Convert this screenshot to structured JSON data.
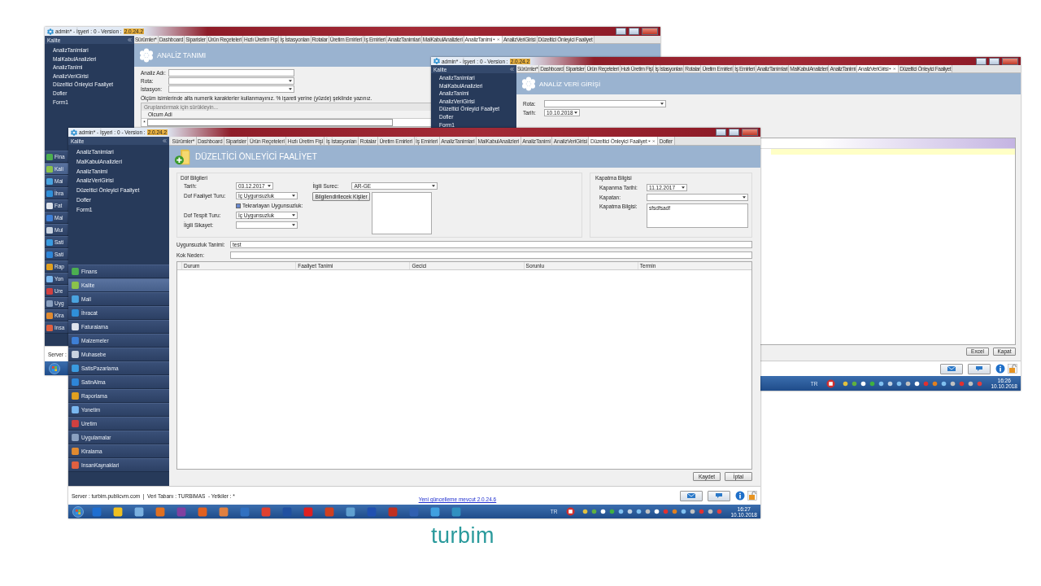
{
  "back_window": {
    "title": "admin* - İşyeri : 0 - Version :",
    "version": "2.0.24.2",
    "sidebar": {
      "header": "Kalite",
      "items": [
        "AnalizTanimlari",
        "MalKabulAnalizleri",
        "AnalizTanimi",
        "AnalizVeriGirisi",
        "Düzeltici Önleyici Faaliyet",
        "Dofler",
        "Form1"
      ]
    },
    "modules": [
      {
        "label": "Fina",
        "selected": false
      },
      {
        "label": "Kali",
        "selected": true
      },
      {
        "label": "Mai",
        "selected": false
      },
      {
        "label": "İhra",
        "selected": false
      },
      {
        "label": "Fat",
        "selected": false
      },
      {
        "label": "Mal",
        "selected": false
      },
      {
        "label": "Mul",
        "selected": false
      },
      {
        "label": "Sati",
        "selected": false
      },
      {
        "label": "Sati",
        "selected": false
      },
      {
        "label": "Rap",
        "selected": false
      },
      {
        "label": "Yon",
        "selected": false
      },
      {
        "label": "Ure",
        "selected": false
      },
      {
        "label": "Uyg",
        "selected": false
      },
      {
        "label": "Kira",
        "selected": false
      },
      {
        "label": "Insa",
        "selected": false
      }
    ],
    "tabs": [
      {
        "label": "Sürümler*",
        "selected": false
      },
      {
        "label": "Dashboard",
        "selected": false
      },
      {
        "label": "Siparisler",
        "selected": false
      },
      {
        "label": "Ürün Reçeteleri",
        "selected": false
      },
      {
        "label": "Hızlı Üretim Fişi",
        "selected": false
      },
      {
        "label": "İş İstasyonları",
        "selected": false
      },
      {
        "label": "Rotalar",
        "selected": false
      },
      {
        "label": "Üretim Emirleri",
        "selected": false
      },
      {
        "label": "İş Emirleri",
        "selected": false
      },
      {
        "label": "AnalizTanimlari",
        "selected": false
      },
      {
        "label": "MalKabulAnalizleri",
        "selected": false
      },
      {
        "label": "AnalizTanimi",
        "selected": true
      },
      {
        "label": "AnalizVeriGirisi",
        "selected": false
      },
      {
        "label": "Düzeltici Önleyici Faaliyet",
        "selected": false
      }
    ],
    "page_title": "ANALİZ TANIMI",
    "fields": [
      {
        "label": "Analiz Adı:",
        "kind": "text"
      },
      {
        "label": "Rota:",
        "kind": "dropdown"
      },
      {
        "label": "İstasyon:",
        "kind": "dropdown"
      }
    ],
    "note": "Ölçüm isimlerinde alfa numerik karakterler kullanmayınız. % işareti yerine (yüzde) şeklinde yazınız.",
    "grid": {
      "group_hint": "Gruplandırmak için sürükleyin...",
      "columns": [
        "Olcum Adi"
      ],
      "new_row_marker": "*"
    },
    "status": "Server :"
  },
  "middle_window": {
    "title": "admin* - İşyeri : 0 - Version :",
    "version": "2.0.24.2",
    "sidebar": {
      "header": "Kalite",
      "items": [
        "AnalizTanimlari",
        "MalKabulAnalizleri",
        "AnalizTanimi",
        "AnalizVeriGirisi",
        "Düzeltici Önleyici Faaliyet",
        "Dofler",
        "Form1"
      ]
    },
    "tabs": [
      {
        "label": "Sürümler*",
        "selected": false
      },
      {
        "label": "Dashboard",
        "selected": false
      },
      {
        "label": "Siparisler",
        "selected": false
      },
      {
        "label": "Ürün Reçeteleri",
        "selected": false
      },
      {
        "label": "Hızlı Üretim Fişi",
        "selected": false
      },
      {
        "label": "İş İstasyonları",
        "selected": false
      },
      {
        "label": "Rotalar",
        "selected": false
      },
      {
        "label": "Üretim Emirleri",
        "selected": false
      },
      {
        "label": "İş Emirleri",
        "selected": false
      },
      {
        "label": "AnalizTanimlari",
        "selected": false
      },
      {
        "label": "MalKabulAnalizleri",
        "selected": false
      },
      {
        "label": "AnalizTanimi",
        "selected": false
      },
      {
        "label": "AnalizVeriGirisi",
        "selected": true
      },
      {
        "label": "Düzeltici Önleyici Faaliyet",
        "selected": false
      }
    ],
    "page_title": "ANALİZ VERİ GİRİŞİ",
    "fields": [
      {
        "label": "Rota:",
        "kind": "dropdown"
      },
      {
        "label": "Tarih:",
        "kind": "date",
        "value": "10.10.2018"
      }
    ],
    "grid": {
      "highlighted_row": true
    },
    "buttons": [
      "Excel",
      "Kapat"
    ],
    "taskbar": {
      "language": "TR",
      "time": "16:26",
      "date": "10.10.2018"
    }
  },
  "front_window": {
    "title": "admin* - İşyeri : 0 - Version :",
    "version": "2.0.24.2",
    "sidebar": {
      "header": "Kalite",
      "items": [
        "AnalizTanimlari",
        "MalKabulAnalizleri",
        "AnalizTanimi",
        "AnalizVeriGirisi",
        "Düzeltici Önleyici Faaliyet",
        "Dofler",
        "Form1"
      ]
    },
    "modules": [
      {
        "label": "Finans",
        "selected": false
      },
      {
        "label": "Kalite",
        "selected": true
      },
      {
        "label": "Mail",
        "selected": false
      },
      {
        "label": "İhracat",
        "selected": false
      },
      {
        "label": "Faturalama",
        "selected": false
      },
      {
        "label": "Malzemeler",
        "selected": false
      },
      {
        "label": "Muhasebe",
        "selected": false
      },
      {
        "label": "SatisPazarlama",
        "selected": false
      },
      {
        "label": "SatinAlma",
        "selected": false
      },
      {
        "label": "Raporlama",
        "selected": false
      },
      {
        "label": "Yonetim",
        "selected": false
      },
      {
        "label": "Uretim",
        "selected": false
      },
      {
        "label": "Uygulamalar",
        "selected": false
      },
      {
        "label": "Kiralama",
        "selected": false
      },
      {
        "label": "InsanKaynaklari",
        "selected": false
      }
    ],
    "tabs": [
      {
        "label": "Sürümler*",
        "selected": false
      },
      {
        "label": "Dashboard",
        "selected": false
      },
      {
        "label": "Siparisler",
        "selected": false
      },
      {
        "label": "Ürün Reçeteleri",
        "selected": false
      },
      {
        "label": "Hızlı Üretim Fişi",
        "selected": false
      },
      {
        "label": "İş İstasyonları",
        "selected": false
      },
      {
        "label": "Rotalar",
        "selected": false
      },
      {
        "label": "Üretim Emirleri",
        "selected": false
      },
      {
        "label": "İş Emirleri",
        "selected": false
      },
      {
        "label": "AnalizTanimlari",
        "selected": false
      },
      {
        "label": "MalKabulAnalizleri",
        "selected": false
      },
      {
        "label": "AnalizTanimi",
        "selected": false
      },
      {
        "label": "AnalizVeriGirisi",
        "selected": false
      },
      {
        "label": "Düzeltici Önleyici Faaliyet",
        "selected": true
      },
      {
        "label": "Dofler",
        "selected": false
      }
    ],
    "page_title": "DÜZELTİCİ ÖNLEYİCİ FAALİYET",
    "dof": {
      "title": "Döf Bilgileri",
      "left": [
        {
          "label": "Tarih:",
          "kind": "date",
          "value": "03.12.2017"
        },
        {
          "label": "Dof Faaliyet Turu:",
          "kind": "dropdown",
          "value": "İç Uygunsuzluk"
        },
        {
          "label": "Tekrarlayan Uygunsuzluk:",
          "kind": "checkbox",
          "checked": true
        },
        {
          "label": "Dof Tespit Turu:",
          "kind": "dropdown",
          "value": "İç Uygunsuzluk"
        },
        {
          "label": "İlgili Sikayet:",
          "kind": "dropdown"
        }
      ],
      "process": {
        "label": "İlgili Surec:",
        "kind": "dropdown",
        "value": "AR-GE"
      },
      "people_button": "Bilgilendirilecek Kişiler"
    },
    "closing": {
      "title": "Kapatma Bilgisi",
      "fields": [
        {
          "label": "Kapanma Tarihi:",
          "kind": "date",
          "value": "11.12.2017"
        },
        {
          "label": "Kapatan:",
          "kind": "dropdown"
        },
        {
          "label": "Kapatma Bilgisi:",
          "kind": "memo",
          "value": "sfsdfsadf"
        }
      ]
    },
    "text_rows": [
      {
        "label": "Uygunsuzluk Tanimi:",
        "kind": "text",
        "value": "test"
      },
      {
        "label": "Kok Neden:",
        "kind": "text"
      }
    ],
    "table": {
      "columns": [
        "Durum",
        "Faaliyet Tanimi",
        "Gecici",
        "Sorunlu",
        "Termin"
      ]
    },
    "buttons": [
      "Kaydet",
      "İptal"
    ],
    "status": "Server : turbim.publicvm.com  |  Veri Tabanı : TURBIMAS  - Yetkiler : *",
    "update_link": "Yeni güncelleme mevcut 2.0.24.6",
    "taskbar": {
      "language": "TR",
      "time": "16:27",
      "date": "10.10.2018"
    }
  },
  "logo": "turbim"
}
